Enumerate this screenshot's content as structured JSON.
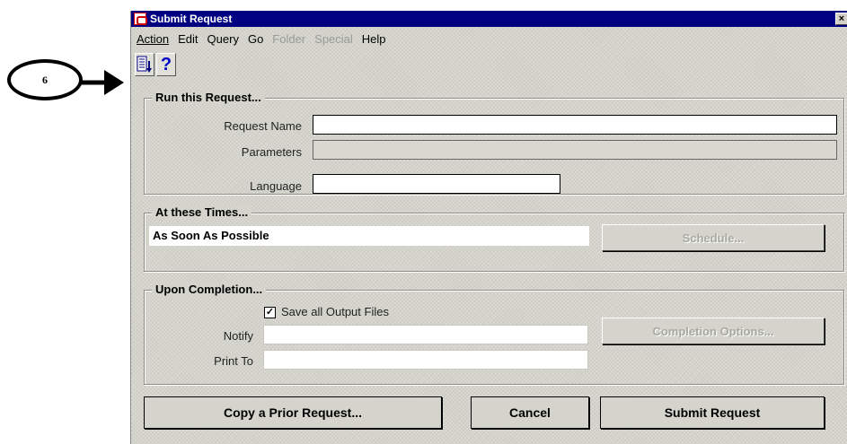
{
  "callout": {
    "number": "6"
  },
  "window": {
    "title": "Submit Request",
    "close_label": "×"
  },
  "menu": [
    "Action",
    "Edit",
    "Query",
    "Go",
    "Folder",
    "Special",
    "Help"
  ],
  "toolbar": {
    "help_label": "?"
  },
  "run_group": {
    "title": "Run this Request...",
    "request_name_label": "Request Name",
    "request_name_value": "",
    "parameters_label": "Parameters",
    "parameters_value": "",
    "language_label": "Language",
    "language_value": ""
  },
  "times_group": {
    "title": "At these Times...",
    "schedule_text": "As Soon As Possible",
    "schedule_button": "Schedule..."
  },
  "completion_group": {
    "title": "Upon Completion...",
    "save_output_label": "Save all Output Files",
    "save_output_checked": true,
    "notify_label": "Notify",
    "notify_value": "",
    "print_to_label": "Print To",
    "print_to_value": "",
    "completion_options_button": "Completion Options..."
  },
  "buttons": {
    "copy_prior": "Copy a Prior Request...",
    "cancel": "Cancel",
    "submit": "Submit Request"
  }
}
